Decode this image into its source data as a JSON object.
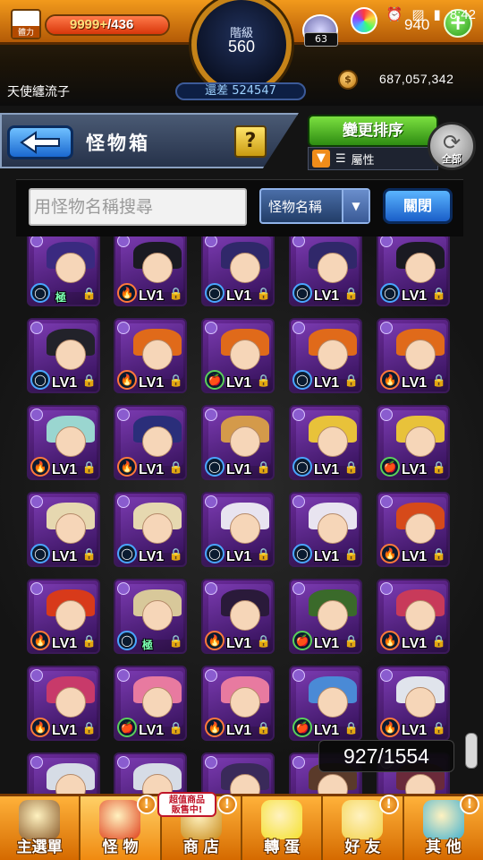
{
  "header": {
    "stamina_label": "體力",
    "stamina_current": "9999+",
    "stamina_max": "/436",
    "rank_label": "階級",
    "rank_value": "560",
    "exp_label": "還差 524547",
    "player_name": "天使纏流子",
    "orb_count": "63",
    "orb_total": "940",
    "gold_amount": "687,057,342",
    "clock": "8:42"
  },
  "title_bar": {
    "title": "怪物箱",
    "help_label": "?",
    "sort_button": "變更排序",
    "filter_label": "屬性",
    "all_label": "全部"
  },
  "search": {
    "placeholder": "用怪物名稱搜尋",
    "select_value": "怪物名稱",
    "close_button": "關閉"
  },
  "monster_grid": {
    "level_label": "LV1",
    "rows": [
      [
        {
          "hair": "#3a2a80",
          "elem": "water",
          "badge": "極",
          "lv": ""
        },
        {
          "hair": "#1a1a22",
          "elem": "fire",
          "badge": "",
          "lv": "LV1"
        },
        {
          "hair": "#30286a",
          "elem": "water",
          "badge": "",
          "lv": "LV1"
        },
        {
          "hair": "#30286a",
          "elem": "water",
          "badge": "",
          "lv": "LV1"
        },
        {
          "hair": "#1a1a22",
          "elem": "water",
          "badge": "",
          "lv": "LV1"
        }
      ],
      [
        {
          "hair": "#22222a",
          "elem": "water",
          "badge": "",
          "lv": "LV1"
        },
        {
          "hair": "#e06a1a",
          "elem": "fire",
          "badge": "",
          "lv": "LV1"
        },
        {
          "hair": "#e06a1a",
          "elem": "wood",
          "badge": "",
          "lv": "LV1"
        },
        {
          "hair": "#e06a1a",
          "elem": "water",
          "badge": "",
          "lv": "LV1"
        },
        {
          "hair": "#e06a1a",
          "elem": "fire",
          "badge": "",
          "lv": "LV1"
        }
      ],
      [
        {
          "hair": "#9ad6d0",
          "elem": "fire",
          "badge": "",
          "lv": "LV1"
        },
        {
          "hair": "#2a2e7a",
          "elem": "fire",
          "badge": "",
          "lv": "LV1"
        },
        {
          "hair": "#d49a4a",
          "elem": "water",
          "badge": "",
          "lv": "LV1"
        },
        {
          "hair": "#e8c23a",
          "elem": "water",
          "badge": "",
          "lv": "LV1"
        },
        {
          "hair": "#e8c23a",
          "elem": "wood",
          "badge": "",
          "lv": "LV1"
        }
      ],
      [
        {
          "hair": "#e6d8b0",
          "elem": "water",
          "badge": "",
          "lv": "LV1"
        },
        {
          "hair": "#e6d8b0",
          "elem": "water",
          "badge": "",
          "lv": "LV1"
        },
        {
          "hair": "#e8e4f0",
          "elem": "water",
          "badge": "",
          "lv": "LV1"
        },
        {
          "hair": "#e8e4f0",
          "elem": "water",
          "badge": "",
          "lv": "LV1"
        },
        {
          "hair": "#d64a1a",
          "elem": "fire",
          "badge": "",
          "lv": "LV1"
        }
      ],
      [
        {
          "hair": "#d83a1a",
          "elem": "fire",
          "badge": "",
          "lv": "LV1"
        },
        {
          "hair": "#d8c89a",
          "elem": "water",
          "badge": "極",
          "lv": ""
        },
        {
          "hair": "#2a1a3a",
          "elem": "fire",
          "badge": "",
          "lv": "LV1"
        },
        {
          "hair": "#3a6a2a",
          "elem": "wood",
          "badge": "",
          "lv": "LV1"
        },
        {
          "hair": "#c83a5a",
          "elem": "fire",
          "badge": "",
          "lv": "LV1"
        }
      ],
      [
        {
          "hair": "#c83a6a",
          "elem": "fire",
          "badge": "",
          "lv": "LV1"
        },
        {
          "hair": "#e87aa0",
          "elem": "wood",
          "badge": "",
          "lv": "LV1"
        },
        {
          "hair": "#e87aa0",
          "elem": "fire",
          "badge": "",
          "lv": "LV1"
        },
        {
          "hair": "#4a8ad6",
          "elem": "wood",
          "badge": "",
          "lv": "LV1"
        },
        {
          "hair": "#e0e4ec",
          "elem": "fire",
          "badge": "",
          "lv": "LV1"
        }
      ],
      [
        {
          "hair": "#d6dce6",
          "elem": "fire",
          "badge": "",
          "lv": ""
        },
        {
          "hair": "#d6dce6",
          "elem": "fire",
          "badge": "",
          "lv": ""
        },
        {
          "hair": "#3a2a5a",
          "elem": "water",
          "badge": "",
          "lv": ""
        },
        {
          "hair": "#5a3a2a",
          "elem": "fire",
          "badge": "",
          "lv": ""
        },
        {
          "hair": "#6a2a3a",
          "elem": "fire",
          "badge": "",
          "lv": ""
        }
      ]
    ]
  },
  "box_counter": "927/1554",
  "bottom_nav": {
    "items": [
      {
        "label": "主選單",
        "icon": "castle-icon",
        "alert": ""
      },
      {
        "label": "怪 物",
        "icon": "monster-icon",
        "alert": "!"
      },
      {
        "label": "商 店",
        "icon": "shop-icon",
        "alert": "!"
      },
      {
        "label": "轉 蛋",
        "icon": "egg-icon",
        "alert": ""
      },
      {
        "label": "好 友",
        "icon": "friends-icon",
        "alert": "!"
      },
      {
        "label": "其 他",
        "icon": "other-icon",
        "alert": "!"
      }
    ],
    "sale_tag_line1": "超值商品",
    "sale_tag_line2": "販售中!"
  },
  "colors": {
    "accent_orange": "#f29a1c",
    "card_purple": "#6a2a9a",
    "sort_green": "#2e8c12",
    "close_blue": "#1a5ec8"
  }
}
